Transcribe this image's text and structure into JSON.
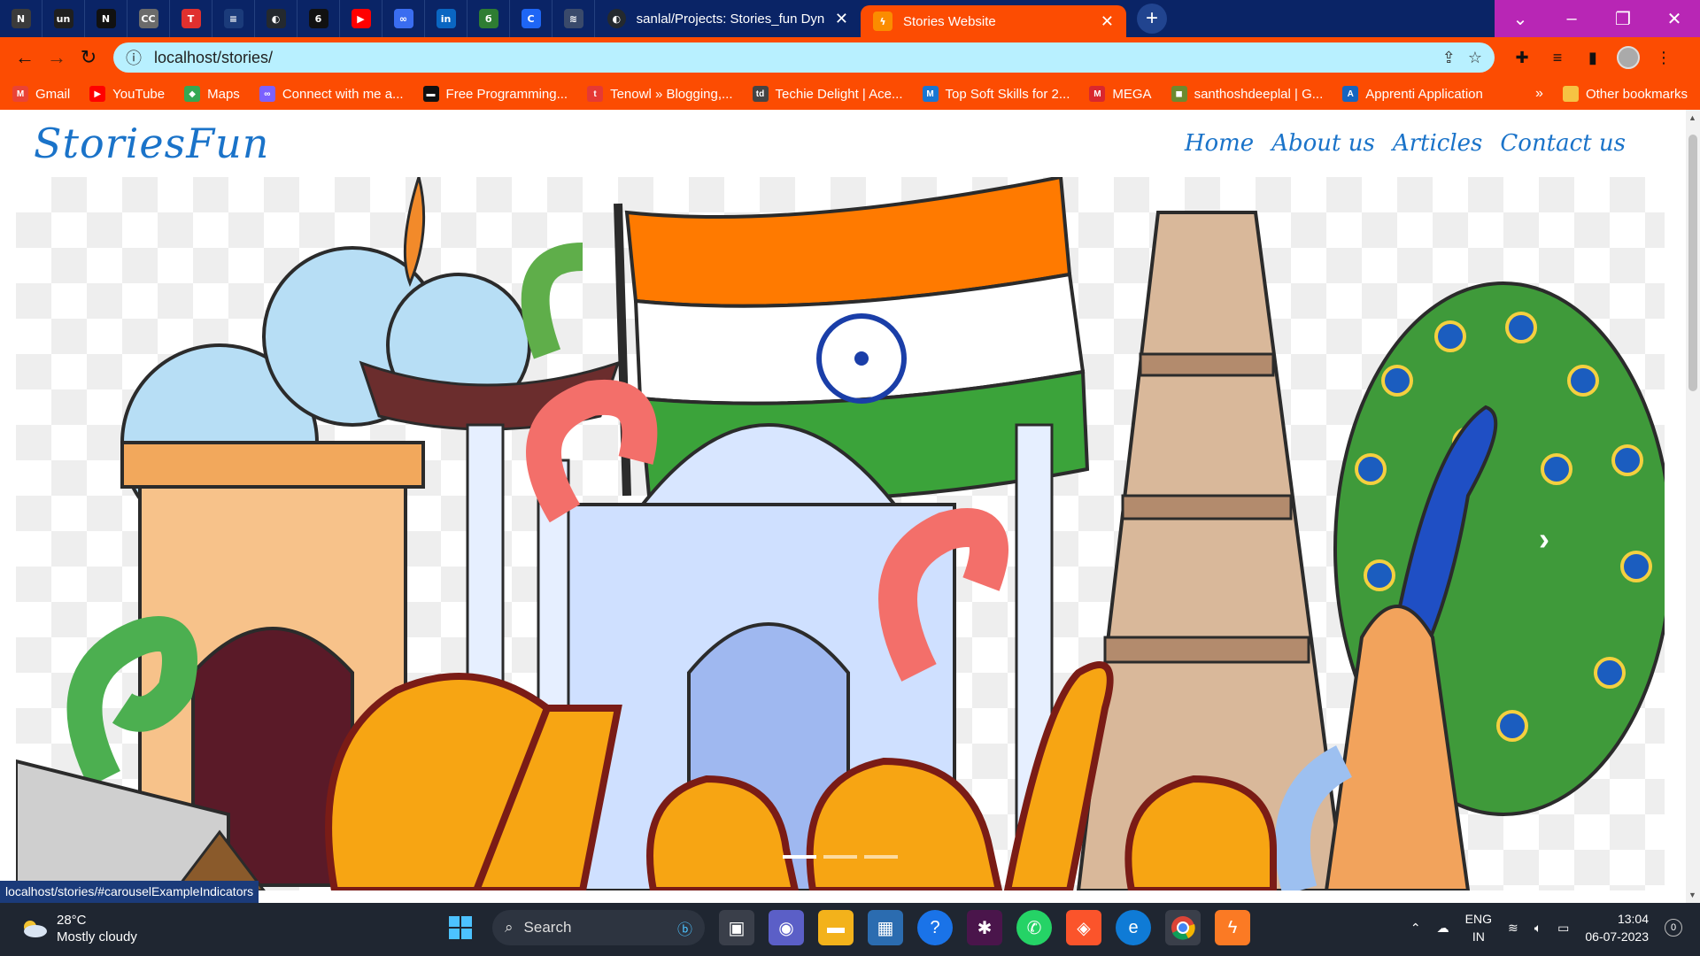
{
  "browser": {
    "pinned_tabs": [
      {
        "icon": "tech-news-icon",
        "color": "#3b3b3b",
        "glyph": "N"
      },
      {
        "icon": "un-icon",
        "color": "#1f1f1f",
        "glyph": "un"
      },
      {
        "icon": "nu-icon",
        "color": "#111111",
        "glyph": "N"
      },
      {
        "icon": "cc-icon",
        "color": "#6b6b6b",
        "glyph": "CC"
      },
      {
        "icon": "tuf-icon",
        "color": "#e0302e",
        "glyph": "T"
      },
      {
        "icon": "web-dev-icon",
        "color": "#1b3b7a",
        "glyph": "≡"
      },
      {
        "icon": "github-icon",
        "color": "#24292e",
        "glyph": "◐"
      },
      {
        "icon": "code-icon",
        "color": "#111111",
        "glyph": "6"
      },
      {
        "icon": "youtube-icon",
        "color": "#ff0000",
        "glyph": "▶"
      },
      {
        "icon": "ui-icon",
        "color": "#3a6df0",
        "glyph": "∞"
      },
      {
        "icon": "linkedin-icon",
        "color": "#0a66c2",
        "glyph": "in"
      },
      {
        "icon": "leaf-icon",
        "color": "#2e7d32",
        "glyph": "ϭ"
      },
      {
        "icon": "c-icon",
        "color": "#1e66f5",
        "glyph": "C"
      },
      {
        "icon": "cisco-icon",
        "color": "#3a4a6b",
        "glyph": "≋"
      }
    ],
    "tabs": {
      "github_tab_title": "sanlal/Projects: Stories_fun Dynar",
      "active_tab_title": "Stories Website"
    },
    "url": "localhost/stories/",
    "bookmarks": [
      {
        "label": "Gmail",
        "color": "#ea4335",
        "glyph": "M"
      },
      {
        "label": "YouTube",
        "color": "#ff0000",
        "glyph": "▶"
      },
      {
        "label": "Maps",
        "color": "#34a853",
        "glyph": "◆"
      },
      {
        "label": "Connect with me a...",
        "color": "#7b61ff",
        "glyph": "∞"
      },
      {
        "label": "Free Programming...",
        "color": "#111111",
        "glyph": "▬"
      },
      {
        "label": "Tenowl » Blogging,...",
        "color": "#e53935",
        "glyph": "t"
      },
      {
        "label": "Techie Delight | Ace...",
        "color": "#444444",
        "glyph": "td"
      },
      {
        "label": "Top Soft Skills for 2...",
        "color": "#1976d2",
        "glyph": "M"
      },
      {
        "label": "MEGA",
        "color": "#d9272e",
        "glyph": "M"
      },
      {
        "label": "santhoshdeeplal | G...",
        "color": "#6d8a2f",
        "glyph": "◼"
      },
      {
        "label": "Apprenti Application",
        "color": "#1565c0",
        "glyph": "A"
      }
    ],
    "other_bookmarks": "Other bookmarks",
    "status_url": "localhost/stories/#carouselExampleIndicators"
  },
  "site": {
    "brand": "StoriesFun",
    "nav": [
      "Home",
      "About us",
      "Articles",
      "Contact us"
    ],
    "carousel": {
      "slides": 3,
      "active_index": 0
    }
  },
  "taskbar": {
    "weather_temp": "28°C",
    "weather_desc": "Mostly cloudy",
    "search_placeholder": "Search",
    "lang_top": "ENG",
    "lang_bottom": "IN",
    "time": "13:04",
    "date": "06-07-2023",
    "notifications": "0"
  }
}
